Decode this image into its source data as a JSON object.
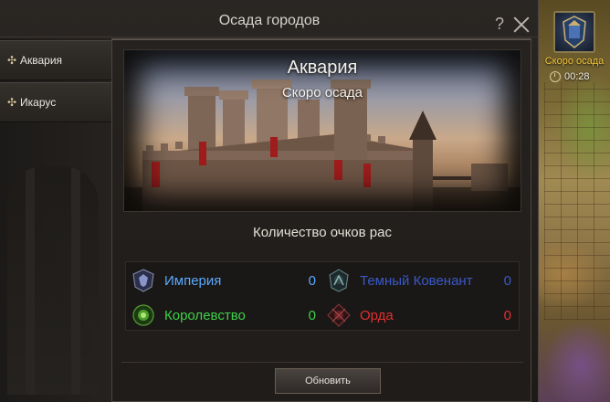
{
  "window": {
    "title": "Осада городов",
    "help_label": "?"
  },
  "sidebar": {
    "items": [
      {
        "label": "Аквария",
        "icon": "plus-icon"
      },
      {
        "label": "Икарус",
        "icon": "plus-icon"
      }
    ]
  },
  "banner": {
    "title": "Аквария",
    "subtitle": "Скоро осада"
  },
  "scores": {
    "title": "Количество очков рас",
    "races": [
      {
        "name": "Империя",
        "value": "0",
        "color": "#5aa8ff",
        "icon": "empire-emblem-icon"
      },
      {
        "name": "Темный Ковенант",
        "value": "0",
        "color": "#3a58c8",
        "icon": "dark-covenant-emblem-icon"
      },
      {
        "name": "Королевство",
        "value": "0",
        "color": "#3fd04a",
        "icon": "kingdom-emblem-icon"
      },
      {
        "name": "Орда",
        "value": "0",
        "color": "#e03030",
        "icon": "horde-emblem-icon"
      }
    ]
  },
  "actions": {
    "refresh_label": "Обновить"
  },
  "siege_widget": {
    "label": "Скоро осада",
    "timer": "00:28",
    "label_color": "#f2c43a"
  }
}
